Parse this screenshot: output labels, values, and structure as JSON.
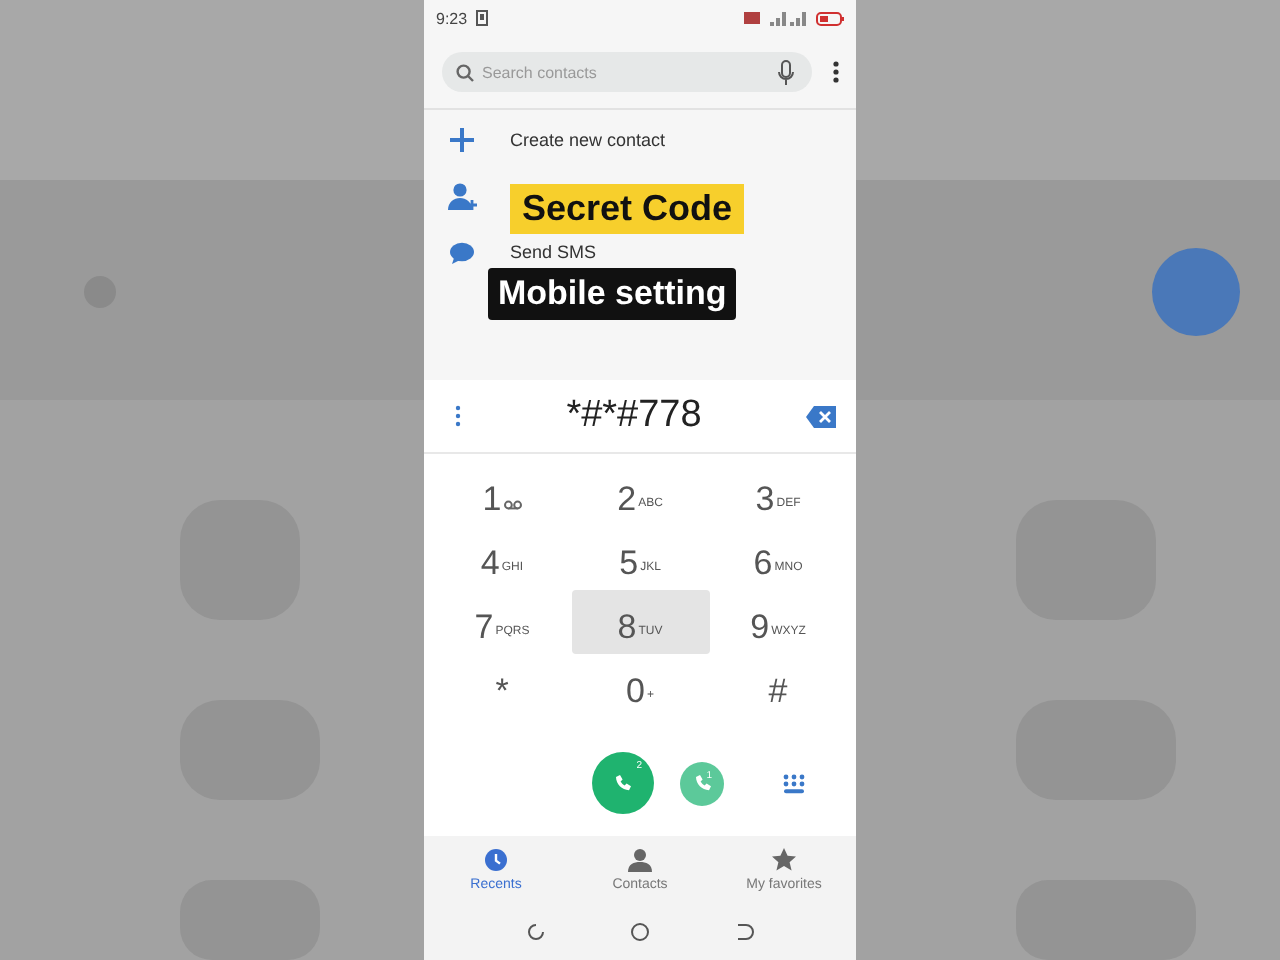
{
  "status_bar": {
    "time": "9:23"
  },
  "search": {
    "placeholder": "Search contacts"
  },
  "actions": [
    {
      "kind": "create",
      "label": "Create new contact"
    },
    {
      "kind": "add-person"
    },
    {
      "kind": "sms",
      "label": "Send SMS"
    }
  ],
  "captions": [
    {
      "kind": "highlight",
      "text": "Secret Code"
    },
    {
      "kind": "dark",
      "text": "Mobile setting"
    }
  ],
  "dialed": "*#*#778",
  "keys": [
    {
      "digit": "1",
      "kind": "voicemail",
      "pressed": false
    },
    {
      "digit": "2",
      "letters": "ABC",
      "pressed": false
    },
    {
      "digit": "3",
      "letters": "DEF",
      "pressed": false
    },
    {
      "digit": "4",
      "letters": "GHI",
      "pressed": false
    },
    {
      "digit": "5",
      "letters": "JKL",
      "pressed": false
    },
    {
      "digit": "6",
      "letters": "MNO",
      "pressed": false
    },
    {
      "digit": "7",
      "letters": "PQRS",
      "pressed": false
    },
    {
      "digit": "8",
      "letters": "TUV",
      "pressed": true
    },
    {
      "digit": "9",
      "letters": "WXYZ",
      "pressed": false
    },
    {
      "digit": "*",
      "pressed": false
    },
    {
      "digit": "0",
      "letters": "+",
      "pressed": false
    },
    {
      "digit": "#",
      "pressed": false
    }
  ],
  "call_buttons": [
    {
      "kind": "primary",
      "sim": "2"
    },
    {
      "kind": "secondary",
      "sim": "1"
    }
  ],
  "tabs": [
    {
      "kind": "recents",
      "label": "Recents",
      "selected": true
    },
    {
      "kind": "contacts",
      "label": "Contacts",
      "selected": false
    },
    {
      "kind": "favorites",
      "label": "My favorites",
      "selected": false
    }
  ]
}
